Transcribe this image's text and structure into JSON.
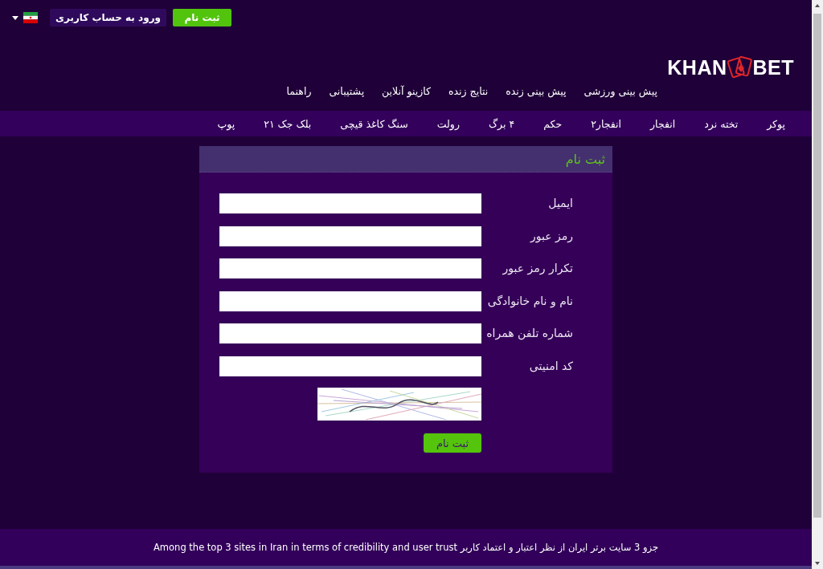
{
  "top_bar": {
    "login_button": "ورود به حساب کاربری",
    "register_button": "ثبت نام"
  },
  "logo": {
    "text_left": "KHAN",
    "text_right": "BET"
  },
  "main_nav": [
    "پیش بینی ورزشی",
    "پیش بینی زنده",
    "نتایج زنده",
    "کازینو آنلاین",
    "پشتیبانی",
    "راهنما"
  ],
  "games_nav": [
    "پوکر",
    "تخته نرد",
    "انفجار",
    "انفجار۲",
    "حکم",
    "۴ برگ",
    "رولت",
    "سنگ کاغذ قیچی",
    "بلک جک ۲۱",
    "پوپ"
  ],
  "registration_form": {
    "title": "ثبت نام",
    "fields": [
      {
        "label": "ایمیل"
      },
      {
        "label": "رمز عبور"
      },
      {
        "label": "تکرار رمز عبور"
      },
      {
        "label": "نام و نام خانوادگی"
      },
      {
        "label": "شماره تلفن همراه"
      },
      {
        "label": "کد امنیتی"
      }
    ],
    "submit_button": "ثبت نام"
  },
  "footer": {
    "text": "جزو 3 سایت برتر ایران از نظر اعتبار و اعتماد کاربر Among the top 3 sites in Iran in terms of credibility and user trust"
  }
}
